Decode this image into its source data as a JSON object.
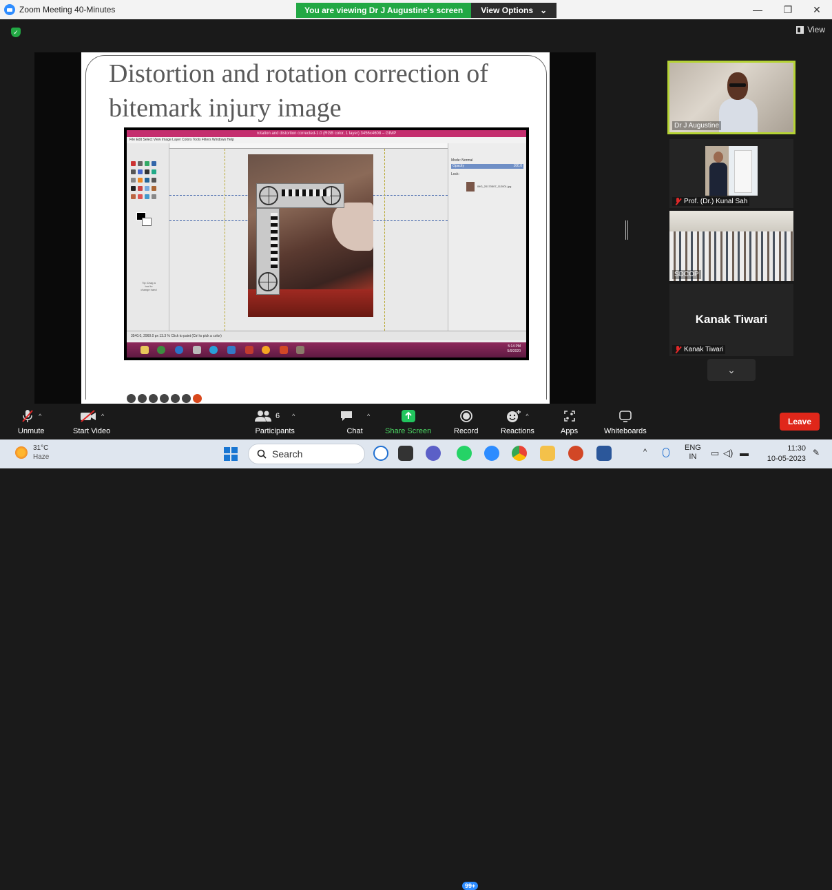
{
  "titlebar": {
    "app_title": "Zoom Meeting 40-Minutes",
    "viewing_banner": "You are viewing Dr J Augustine's screen",
    "view_options": "View Options",
    "minimize": "—",
    "restore": "❐",
    "close": "✕"
  },
  "meeting": {
    "view_label": "View",
    "slide_title": "Distortion and rotation correction of bitemark injury image",
    "gimp_window_title": "rotation and distortion corrected-1.0 (RGB color, 1 layer) 3456x4608 – GIMP",
    "gimp_menu": "File  Edit  Select  View  Image  Layer  Colors  Tools  Filters  Windows  Help",
    "gimp_status": "3540.0, 2960.0   px   13.3 %   Click to paint (Ctrl to pick a color)",
    "gimp_layer_name": "IMG_20170507_112001.jpg",
    "gimp_mode": "Mode: Normal",
    "gimp_opacity": "Opacity",
    "gimp_opacity_value": "100.0",
    "gimp_lock": "Lock:",
    "gimp_clock_time": "5:14 PM",
    "gimp_clock_date": "5/9/2020",
    "toolbox_hint": "Tip: Drag a tool to change hand"
  },
  "participants_panel": {
    "tiles": [
      {
        "name": "Dr J Augustine",
        "muted": false,
        "active_speaker": true
      },
      {
        "name": "Prof. (Dr.) Kunal Sah",
        "muted": true
      },
      {
        "name": "SDCOP",
        "muted": false
      },
      {
        "name": "Kanak Tiwari",
        "muted": true,
        "display_name_large": "Kanak Tiwari"
      }
    ]
  },
  "controls": {
    "unmute": "Unmute",
    "start_video": "Start Video",
    "participants": "Participants",
    "participants_count": "6",
    "chat": "Chat",
    "share_screen": "Share Screen",
    "record": "Record",
    "reactions": "Reactions",
    "apps": "Apps",
    "whiteboards": "Whiteboards",
    "leave": "Leave"
  },
  "taskbar": {
    "temperature": "31°C",
    "weather": "Haze",
    "search_label": "Search",
    "badge": "99+",
    "lang_top": "ENG",
    "lang_bottom": "IN",
    "time": "11:30",
    "date": "10-05-2023",
    "up_caret": "^"
  },
  "colors": {
    "zoom_blue": "#2d8cff",
    "banner_green": "#22a844",
    "leave_red": "#e0271a",
    "active_speaker_border": "#b5d334"
  }
}
